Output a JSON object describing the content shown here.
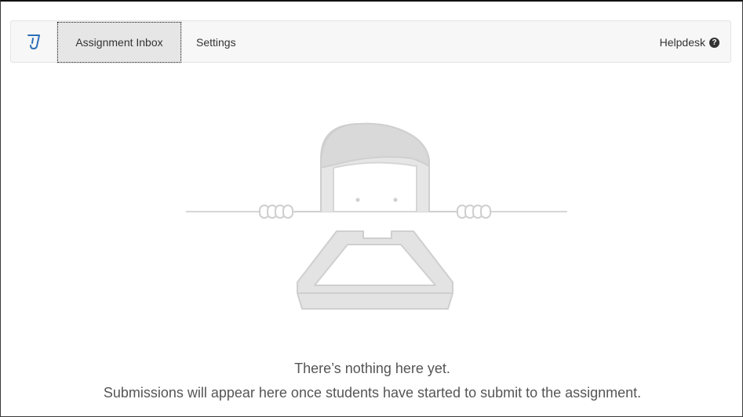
{
  "nav": {
    "tabs": [
      {
        "label": "Assignment Inbox",
        "active": true
      },
      {
        "label": "Settings",
        "active": false
      }
    ],
    "helpdesk_label": "Helpdesk",
    "logo_icon": "turnitin-logo-icon",
    "help_icon": "question-circle-icon"
  },
  "empty_state": {
    "title": "There’s nothing here yet.",
    "subtitle": "Submissions will appear here once students have started to submit to the assignment."
  },
  "colors": {
    "accent": "#2c6fb7",
    "navbar_bg": "#f7f7f7",
    "text": "#555555",
    "illustration": "#dedede"
  }
}
